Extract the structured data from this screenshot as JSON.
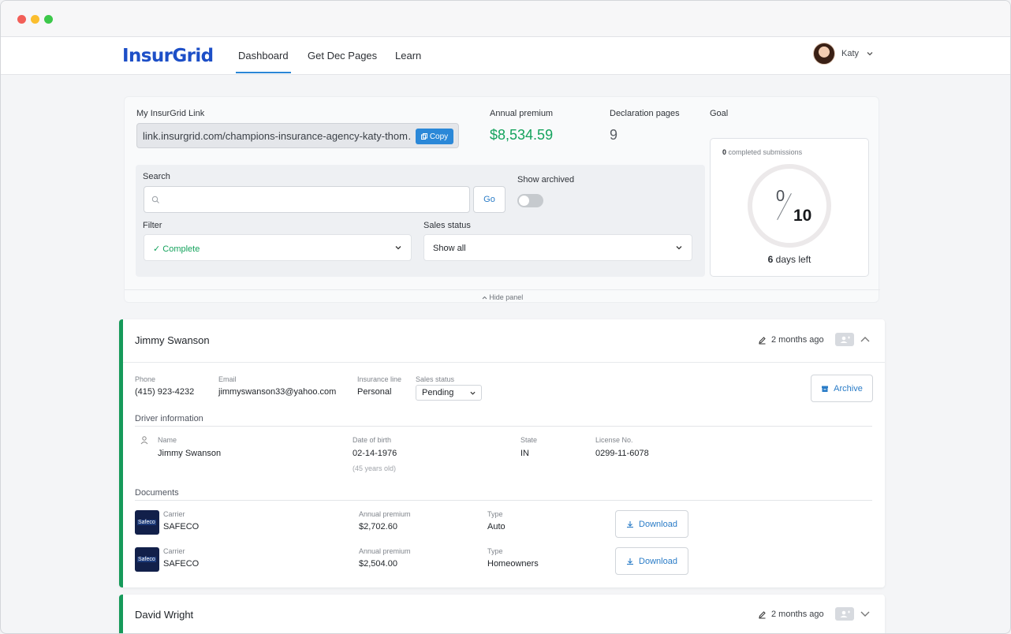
{
  "brand": {
    "name": "InsurGrid"
  },
  "nav": {
    "dashboard": "Dashboard",
    "dec_pages": "Get Dec Pages",
    "learn": "Learn"
  },
  "user": {
    "name": "Katy"
  },
  "panel": {
    "link_label": "My InsurGrid Link",
    "link_value": "link.insurgrid.com/champions-insurance-agency-katy-thom…",
    "copy_label": "Copy",
    "annual_premium_label": "Annual premium",
    "annual_premium_value": "$8,534.59",
    "declaration_label": "Declaration pages",
    "declaration_value": "9",
    "goal_label": "Goal",
    "search_label": "Search",
    "search_placeholder": "",
    "go_label": "Go",
    "show_archived_label": "Show archived",
    "filter_label": "Filter",
    "filter_value": "✓ Complete",
    "sales_status_label": "Sales status",
    "sales_status_value": "Show all",
    "hide_panel_label": "Hide panel"
  },
  "goal": {
    "completed_count": "0",
    "completed_text": "completed submissions",
    "current": "0",
    "target": "10",
    "days_count": "6",
    "days_text": "days left"
  },
  "clients": [
    {
      "name": "Jimmy Swanson",
      "updated": "2 months ago",
      "phone_label": "Phone",
      "phone": "(415) 923-4232",
      "email_label": "Email",
      "email": "jimmyswanson33@yahoo.com",
      "line_label": "Insurance line",
      "line": "Personal",
      "status_label": "Sales status",
      "status": "Pending",
      "archive_label": "Archive",
      "driver_section": "Driver information",
      "driver": {
        "name_label": "Name",
        "name": "Jimmy Swanson",
        "dob_label": "Date of birth",
        "dob": "02-14-1976",
        "age": "(45 years old)",
        "state_label": "State",
        "state": "IN",
        "license_label": "License No.",
        "license": "0299-11-6078"
      },
      "documents_section": "Documents",
      "documents": [
        {
          "carrier_label": "Carrier",
          "carrier": "SAFECO",
          "logo_text": "Safeco",
          "premium_label": "Annual premium",
          "premium": "$2,702.60",
          "type_label": "Type",
          "type": "Auto",
          "download_label": "Download"
        },
        {
          "carrier_label": "Carrier",
          "carrier": "SAFECO",
          "logo_text": "Safeco",
          "premium_label": "Annual premium",
          "premium": "$2,504.00",
          "type_label": "Type",
          "type": "Homeowners",
          "download_label": "Download"
        }
      ]
    },
    {
      "name": "David Wright",
      "updated": "2 months ago"
    }
  ]
}
